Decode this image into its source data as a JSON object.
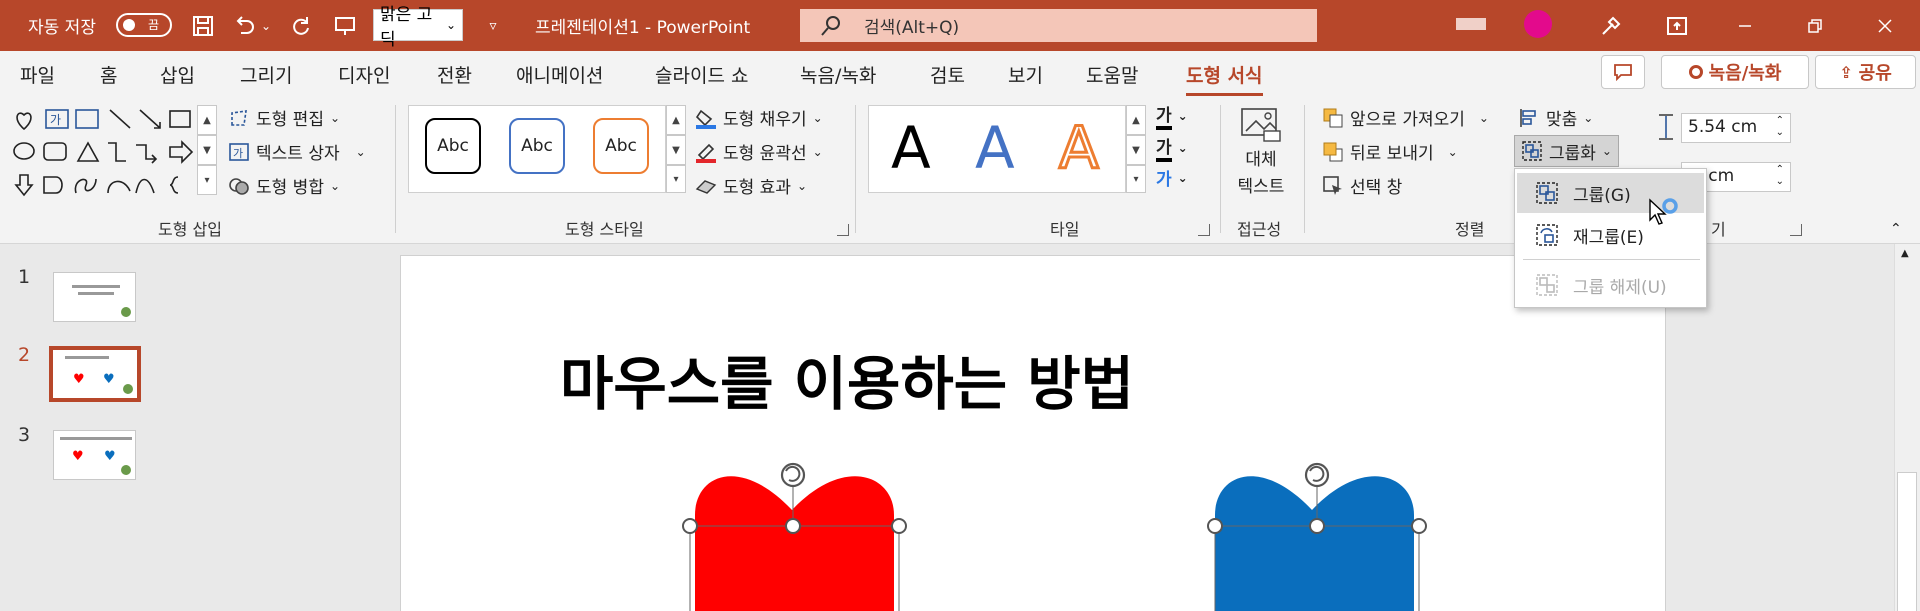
{
  "titlebar": {
    "autosave_label": "자동 저장",
    "autosave_state": "끔",
    "font_value": "맑은 고딕",
    "doc_title": "프레젠테이션1  -  PowerPoint",
    "search_placeholder": "검색(Alt+Q)"
  },
  "tabs": [
    "파일",
    "홈",
    "삽입",
    "그리기",
    "디자인",
    "전환",
    "애니메이션",
    "슬라이드 쇼",
    "녹음/녹화",
    "검토",
    "보기",
    "도움말",
    "도형 서식"
  ],
  "tab_buttons": {
    "record": "녹음/녹화",
    "share": "공유"
  },
  "ribbon": {
    "insert_shapes": {
      "edit_shape": "도형 편집",
      "text_box": "텍스트 상자",
      "merge_shapes": "도형 병합",
      "label": "도형 삽입"
    },
    "shape_styles": {
      "gallery": [
        "Abc",
        "Abc",
        "Abc"
      ],
      "fill": "도형 채우기",
      "outline": "도형 윤곽선",
      "effects": "도형 효과",
      "label": "도형 스타일"
    },
    "wordart": {
      "letters": [
        "A",
        "A",
        "A"
      ],
      "text_fill_glyph": "가",
      "text_outline_glyph": "가",
      "text_effects_glyph": "가",
      "label": "타일"
    },
    "accessibility": {
      "alt_text_line1": "대체",
      "alt_text_line2": "텍스트",
      "label": "접근성"
    },
    "arrange": {
      "bring_forward": "앞으로 가져오기",
      "send_backward": "뒤로 보내기",
      "selection_pane": "선택 창",
      "align": "맞춤",
      "group": "그룹화",
      "label": "정렬"
    },
    "size": {
      "height": "5.54 cm",
      "width": "3 cm",
      "label": "기"
    }
  },
  "group_menu": {
    "items": [
      {
        "label": "그룹(G)",
        "state": "hover"
      },
      {
        "label": "재그룹(E)",
        "state": "enabled"
      },
      {
        "label": "그룹 해제(U)",
        "state": "disabled"
      }
    ]
  },
  "thumbnails": [
    {
      "num": "1",
      "active": false
    },
    {
      "num": "2",
      "active": true
    },
    {
      "num": "3",
      "active": false
    }
  ],
  "slide": {
    "title": "마우스를 이용하는 방법",
    "left_heart_color": "#ff0000",
    "right_heart_color": "#0a6ebd"
  },
  "colors": {
    "accent": "#b7472a",
    "searchbox": "#f4c6b8"
  }
}
